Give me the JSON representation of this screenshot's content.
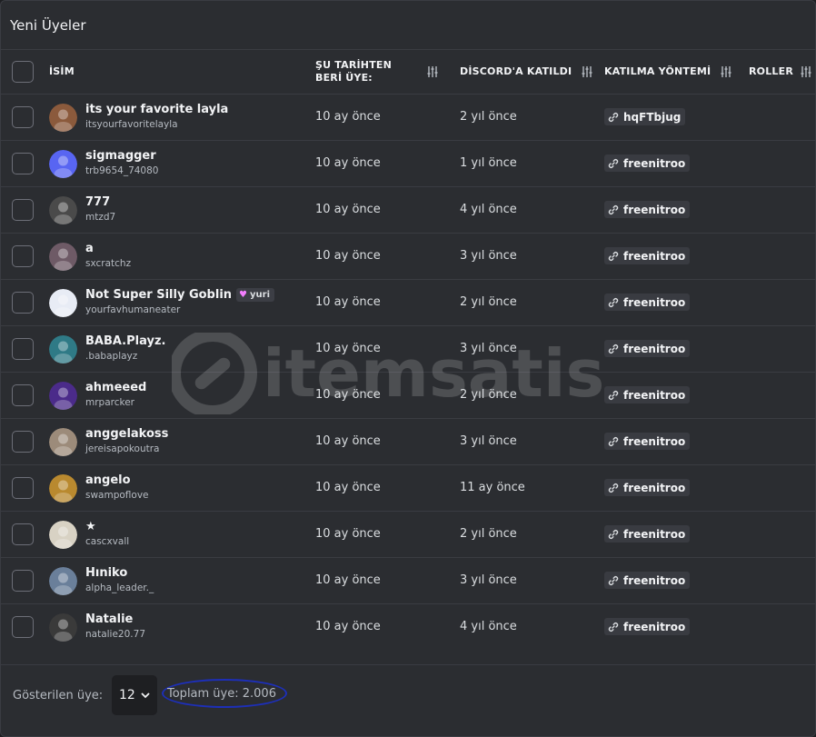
{
  "panel": {
    "title": "Yeni Üyeler"
  },
  "columns": {
    "name": "İSİM",
    "since": "ŞU TARİHTEN BERİ ÜYE:",
    "joined": "DİSCORD'A KATILDI",
    "method": "KATILMA YÖNTEMİ",
    "roles": "ROLLER"
  },
  "members": [
    {
      "name": "its your favorite layla",
      "username": "itsyourfavoritelayla",
      "since": "10 ay önce",
      "joined": "2 yıl önce",
      "invite": "hqFTbjug",
      "avatar_color": "#8b5a3c"
    },
    {
      "name": "sigmagger",
      "username": "trb9654_74080",
      "since": "10 ay önce",
      "joined": "1 yıl önce",
      "invite": "freenitroo",
      "avatar_color": "#5865f2"
    },
    {
      "name": "777",
      "username": "mtzd7",
      "since": "10 ay önce",
      "joined": "4 yıl önce",
      "invite": "freenitroo",
      "avatar_color": "#4a4a4a"
    },
    {
      "name": "a",
      "username": "sxcratchz",
      "since": "10 ay önce",
      "joined": "3 yıl önce",
      "invite": "freenitroo",
      "avatar_color": "#6e5a66"
    },
    {
      "name": "Not Super Silly Goblin",
      "username": "yourfavhumaneater",
      "since": "10 ay önce",
      "joined": "2 yıl önce",
      "invite": "freenitroo",
      "tag": "yuri",
      "avatar_color": "#e8ecf5"
    },
    {
      "name": "BABA.Playz.",
      "username": ".babaplayz",
      "since": "10 ay önce",
      "joined": "3 yıl önce",
      "invite": "freenitroo",
      "avatar_color": "#2f7a86"
    },
    {
      "name": "ahmeeed",
      "username": "mrparcker",
      "since": "10 ay önce",
      "joined": "2 yıl önce",
      "invite": "freenitroo",
      "avatar_color": "#4b2b8a"
    },
    {
      "name": "anggelakoss",
      "username": "jereisapokoutra",
      "since": "10 ay önce",
      "joined": "3 yıl önce",
      "invite": "freenitroo",
      "avatar_color": "#9c8b7a"
    },
    {
      "name": "angelo",
      "username": "swampoflove",
      "since": "10 ay önce",
      "joined": "11 ay önce",
      "invite": "freenitroo",
      "avatar_color": "#b9892f"
    },
    {
      "name": "★",
      "username": "cascxvall",
      "since": "10 ay önce",
      "joined": "2 yıl önce",
      "invite": "freenitroo",
      "avatar_color": "#d8d2c4"
    },
    {
      "name": "Hıniko",
      "username": "alpha_leader._",
      "since": "10 ay önce",
      "joined": "3 yıl önce",
      "invite": "freenitroo",
      "avatar_color": "#6a7f9a"
    },
    {
      "name": "Natalie",
      "username": "natalie20.77",
      "since": "10 ay önce",
      "joined": "4 yıl önce",
      "invite": "freenitroo",
      "avatar_color": "#3a3a3a"
    }
  ],
  "footer": {
    "shown_label": "Gösterilen üye:",
    "page_size": "12",
    "total": "Toplam üye: 2.006"
  },
  "watermark": {
    "text": "itemsatis"
  }
}
